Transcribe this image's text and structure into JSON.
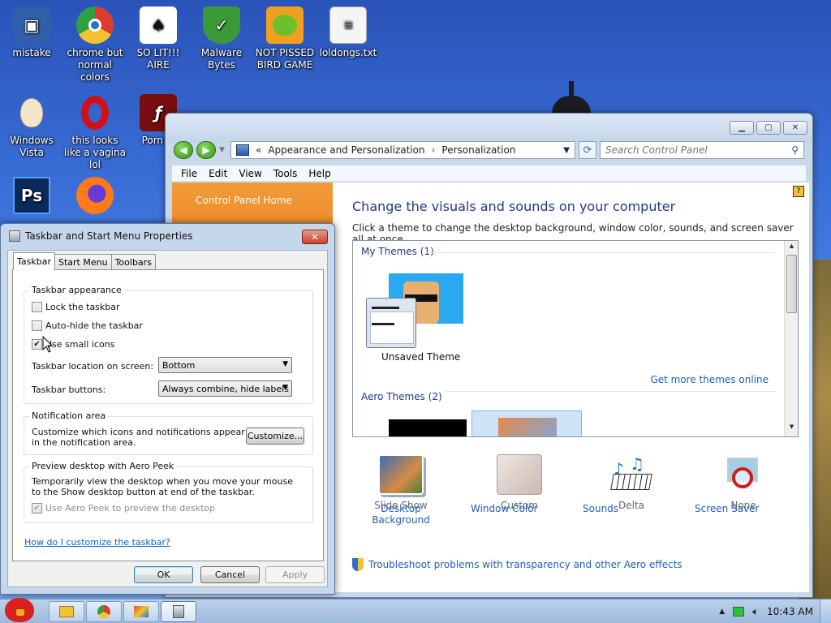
{
  "desktop": {
    "icons": [
      {
        "label": "mistake",
        "icon": "computer-icon",
        "color": "#2f5fa8"
      },
      {
        "label": "chrome but normal colors",
        "icon": "chrome-icon",
        "color": "#dd3b2f"
      },
      {
        "label": "SO LIT!!! AIRE",
        "icon": "solitaire-icon",
        "color": "#ffffff"
      },
      {
        "label": "Malware Bytes",
        "icon": "shield-icon",
        "color": "#3a9a3a"
      },
      {
        "label": "NOT PISSED BIRD GAME",
        "icon": "pig-icon",
        "color": "#f0a020"
      },
      {
        "label": "loldongs.txt",
        "icon": "text-file-icon",
        "color": "#f5f5f5"
      },
      {
        "label": "Windows Vista",
        "icon": "egg-icon",
        "color": "#f4e7c8"
      },
      {
        "label": "this looks like a vagina lol",
        "icon": "opera-icon",
        "color": "#d2101a"
      },
      {
        "label": "Porn Pl",
        "icon": "flash-icon",
        "color": "#7a0d0d"
      },
      {
        "label": "",
        "icon": "photoshop-icon",
        "color": "#0a2a5a"
      },
      {
        "label": "",
        "icon": "firefox-icon",
        "color": "#ff7a18"
      }
    ]
  },
  "control_panel": {
    "breadcrumb": [
      "Appearance and Personalization",
      "Personalization"
    ],
    "breadcrumb_prefix": "«",
    "search_placeholder": "Search Control Panel",
    "menu": [
      "File",
      "Edit",
      "View",
      "Tools",
      "Help"
    ],
    "left_link": "Control Panel Home",
    "title": "Change the visuals and sounds on your computer",
    "subtitle": "Click a theme to change the desktop background, window color, sounds, and screen saver all at once.",
    "my_themes_label": "My Themes (1)",
    "unsaved_theme_label": "Unsaved Theme",
    "get_more_link": "Get more themes online",
    "aero_themes_label": "Aero Themes (2)",
    "settings": [
      {
        "label": "Desktop Background",
        "value": "Slide Show",
        "icon": "desktop-background-icon"
      },
      {
        "label": "Window Color",
        "value": "Custom",
        "icon": "window-color-icon"
      },
      {
        "label": "Sounds",
        "value": "Delta",
        "icon": "sounds-icon"
      },
      {
        "label": "Screen Saver",
        "value": "None",
        "icon": "screen-saver-icon"
      }
    ],
    "troubleshoot_link": "Troubleshoot problems with transparency and other Aero effects"
  },
  "dialog": {
    "title": "Taskbar and Start Menu Properties",
    "tabs": [
      "Taskbar",
      "Start Menu",
      "Toolbars"
    ],
    "active_tab": "Taskbar",
    "appearance_legend": "Taskbar appearance",
    "lock_label": "Lock the taskbar",
    "lock_checked": false,
    "autohide_label": "Auto-hide the taskbar",
    "autohide_checked": false,
    "small_icons_label": "Use small icons",
    "small_icons_checked": true,
    "location_label": "Taskbar location on screen:",
    "location_value": "Bottom",
    "buttons_label": "Taskbar buttons:",
    "buttons_value": "Always combine, hide labels",
    "notification_legend": "Notification area",
    "notification_text": "Customize which icons and notifications appear in the notification area.",
    "customize_button": "Customize...",
    "peek_legend": "Preview desktop with Aero Peek",
    "peek_text": "Temporarily view the desktop when you move your mouse to the Show desktop button at end of the taskbar.",
    "peek_checkbox": "Use Aero Peek to preview the desktop",
    "peek_checked": true,
    "help_link": "How do I customize the taskbar?",
    "ok": "OK",
    "cancel": "Cancel",
    "apply": "Apply"
  },
  "taskbar": {
    "clock": "10:43 AM",
    "pinned": [
      "explorer-icon",
      "chrome-icon",
      "paint-icon",
      "taskbar-properties-icon"
    ]
  }
}
